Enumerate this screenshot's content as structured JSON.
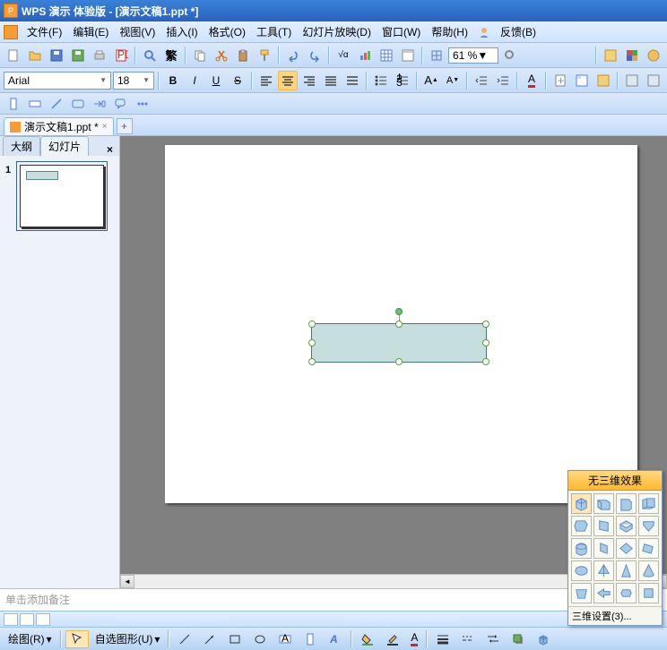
{
  "titlebar": {
    "text": "WPS 演示 体验版 - [演示文稿1.ppt *]"
  },
  "menu": {
    "items": [
      {
        "label": "文件(F)"
      },
      {
        "label": "编辑(E)"
      },
      {
        "label": "视图(V)"
      },
      {
        "label": "插入(I)"
      },
      {
        "label": "格式(O)"
      },
      {
        "label": "工具(T)"
      },
      {
        "label": "幻灯片放映(D)"
      },
      {
        "label": "窗口(W)"
      },
      {
        "label": "帮助(H)"
      },
      {
        "label": "反馈(B)"
      }
    ]
  },
  "format": {
    "font": "Arial",
    "size": "18",
    "zoom": "61 %"
  },
  "doctab": {
    "label": "演示文稿1.ppt *"
  },
  "sidepanel": {
    "tabs": [
      {
        "label": "大纲"
      },
      {
        "label": "幻灯片"
      }
    ],
    "slide_number": "1"
  },
  "notes": {
    "placeholder": "单击添加备注"
  },
  "statusbar": {
    "draw_label": "绘图(R)",
    "autoshape_label": "自选图形(U)"
  },
  "panel3d": {
    "title": "无三维效果",
    "footer": "三维设置(3)..."
  }
}
